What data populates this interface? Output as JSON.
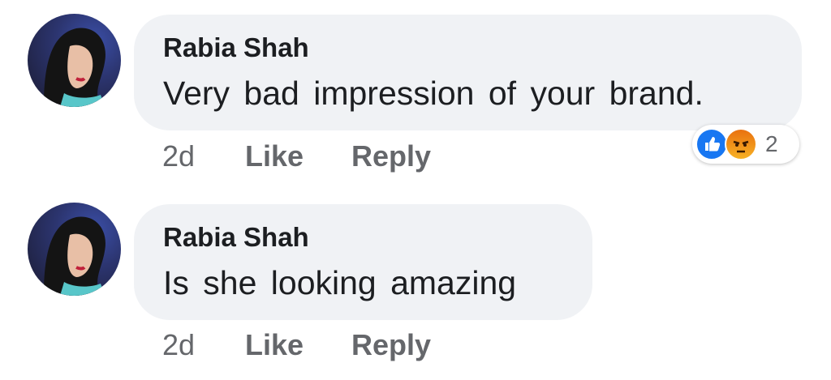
{
  "comments": [
    {
      "author": "Rabia Shah",
      "text": "Very bad impression of your brand.",
      "time": "2d",
      "like_label": "Like",
      "reply_label": "Reply",
      "reactions": {
        "icons": [
          "like-icon",
          "angry-icon"
        ],
        "count": "2"
      }
    },
    {
      "author": "Rabia Shah",
      "text": "Is she looking amazing",
      "time": "2d",
      "like_label": "Like",
      "reply_label": "Reply"
    }
  ],
  "colors": {
    "bubble": "#f0f2f5",
    "meta_text": "#65676b",
    "like_blue": "#1877f2",
    "angry_orange": "#e9710f"
  }
}
